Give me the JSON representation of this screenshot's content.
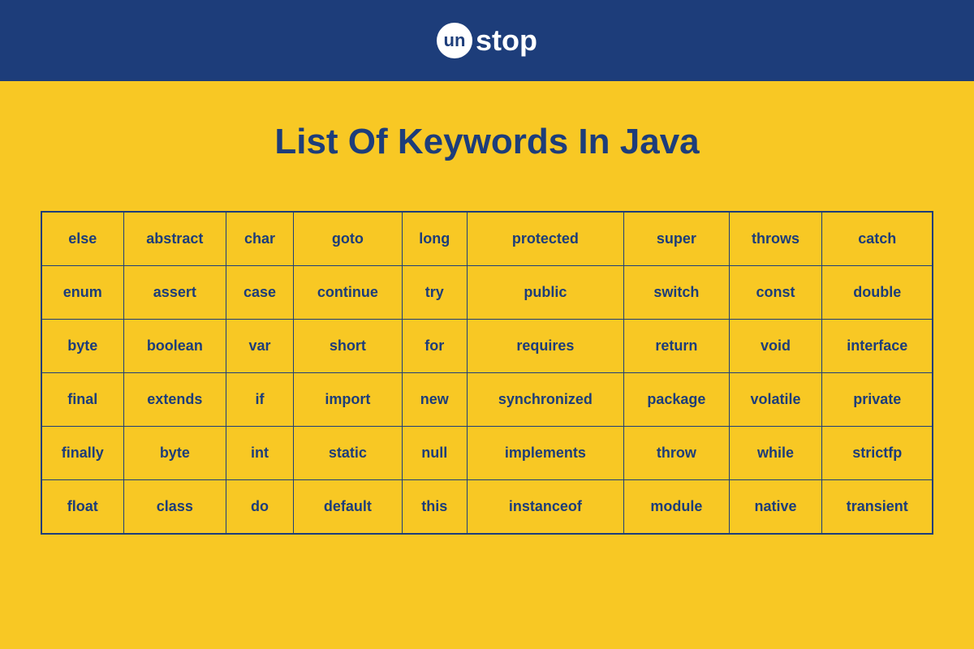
{
  "logo": {
    "circle_text": "un",
    "rest_text": "stop"
  },
  "title": "List Of Keywords In Java",
  "keywords": [
    [
      "else",
      "abstract",
      "char",
      "goto",
      "long",
      "protected",
      "super",
      "throws",
      "catch"
    ],
    [
      "enum",
      "assert",
      "case",
      "continue",
      "try",
      "public",
      "switch",
      "const",
      "double"
    ],
    [
      "byte",
      "boolean",
      "var",
      "short",
      "for",
      "requires",
      "return",
      "void",
      "interface"
    ],
    [
      "final",
      "extends",
      "if",
      "import",
      "new",
      "synchronized",
      "package",
      "volatile",
      "private"
    ],
    [
      "finally",
      "byte",
      "int",
      "static",
      "null",
      "implements",
      "throw",
      "while",
      "strictfp"
    ],
    [
      "float",
      "class",
      "do",
      "default",
      "this",
      "instanceof",
      "module",
      "native",
      "transient"
    ]
  ]
}
